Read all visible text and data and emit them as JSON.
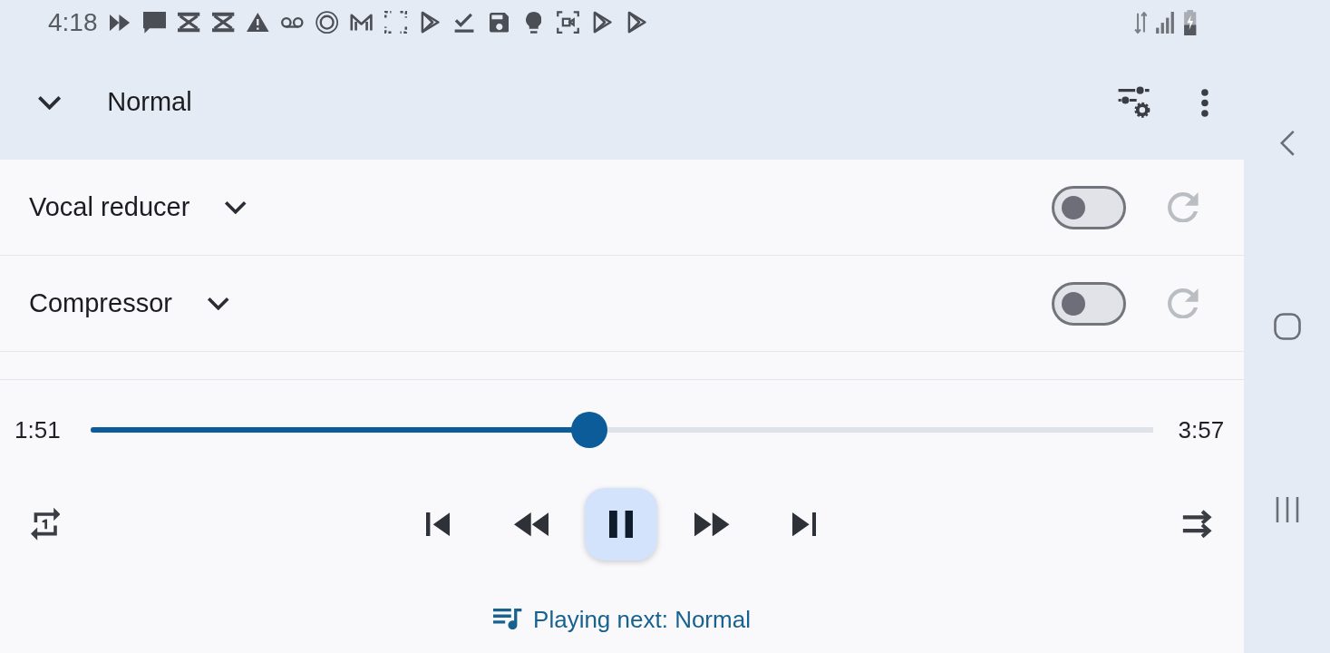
{
  "status_bar": {
    "time": "4:18"
  },
  "header": {
    "title": "Normal"
  },
  "effects": [
    {
      "label": "Vocal reducer",
      "on": false
    },
    {
      "label": "Compressor",
      "on": false
    }
  ],
  "player": {
    "elapsed": "1:51",
    "duration": "3:57",
    "level": 0.47,
    "playing": true,
    "up_next": "Playing next: Normal"
  }
}
